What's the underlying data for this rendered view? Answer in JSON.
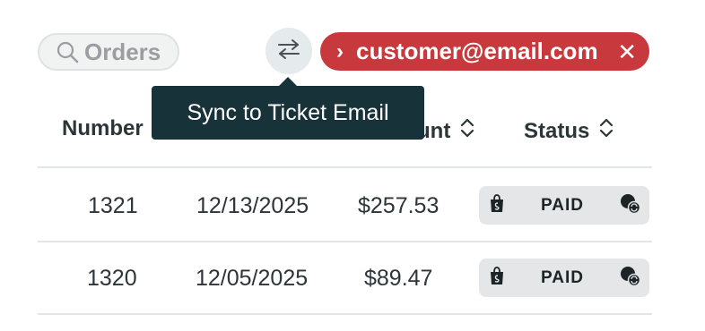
{
  "search": {
    "label": "Orders"
  },
  "sync": {
    "tooltip": "Sync to Ticket Email"
  },
  "customer_chip": {
    "email": "customer@email.com"
  },
  "table": {
    "headers": {
      "number": "Number",
      "amount_partial": "unt",
      "status": "Status"
    },
    "rows": [
      {
        "number": "1321",
        "date": "12/13/2025",
        "amount": "$257.53",
        "status": "PAID"
      },
      {
        "number": "1320",
        "date": "12/05/2025",
        "amount": "$89.47",
        "status": "PAID"
      }
    ]
  },
  "colors": {
    "chip_bg": "#c8393d",
    "tooltip_bg": "#173238",
    "badge_bg": "#e4e6e7"
  }
}
